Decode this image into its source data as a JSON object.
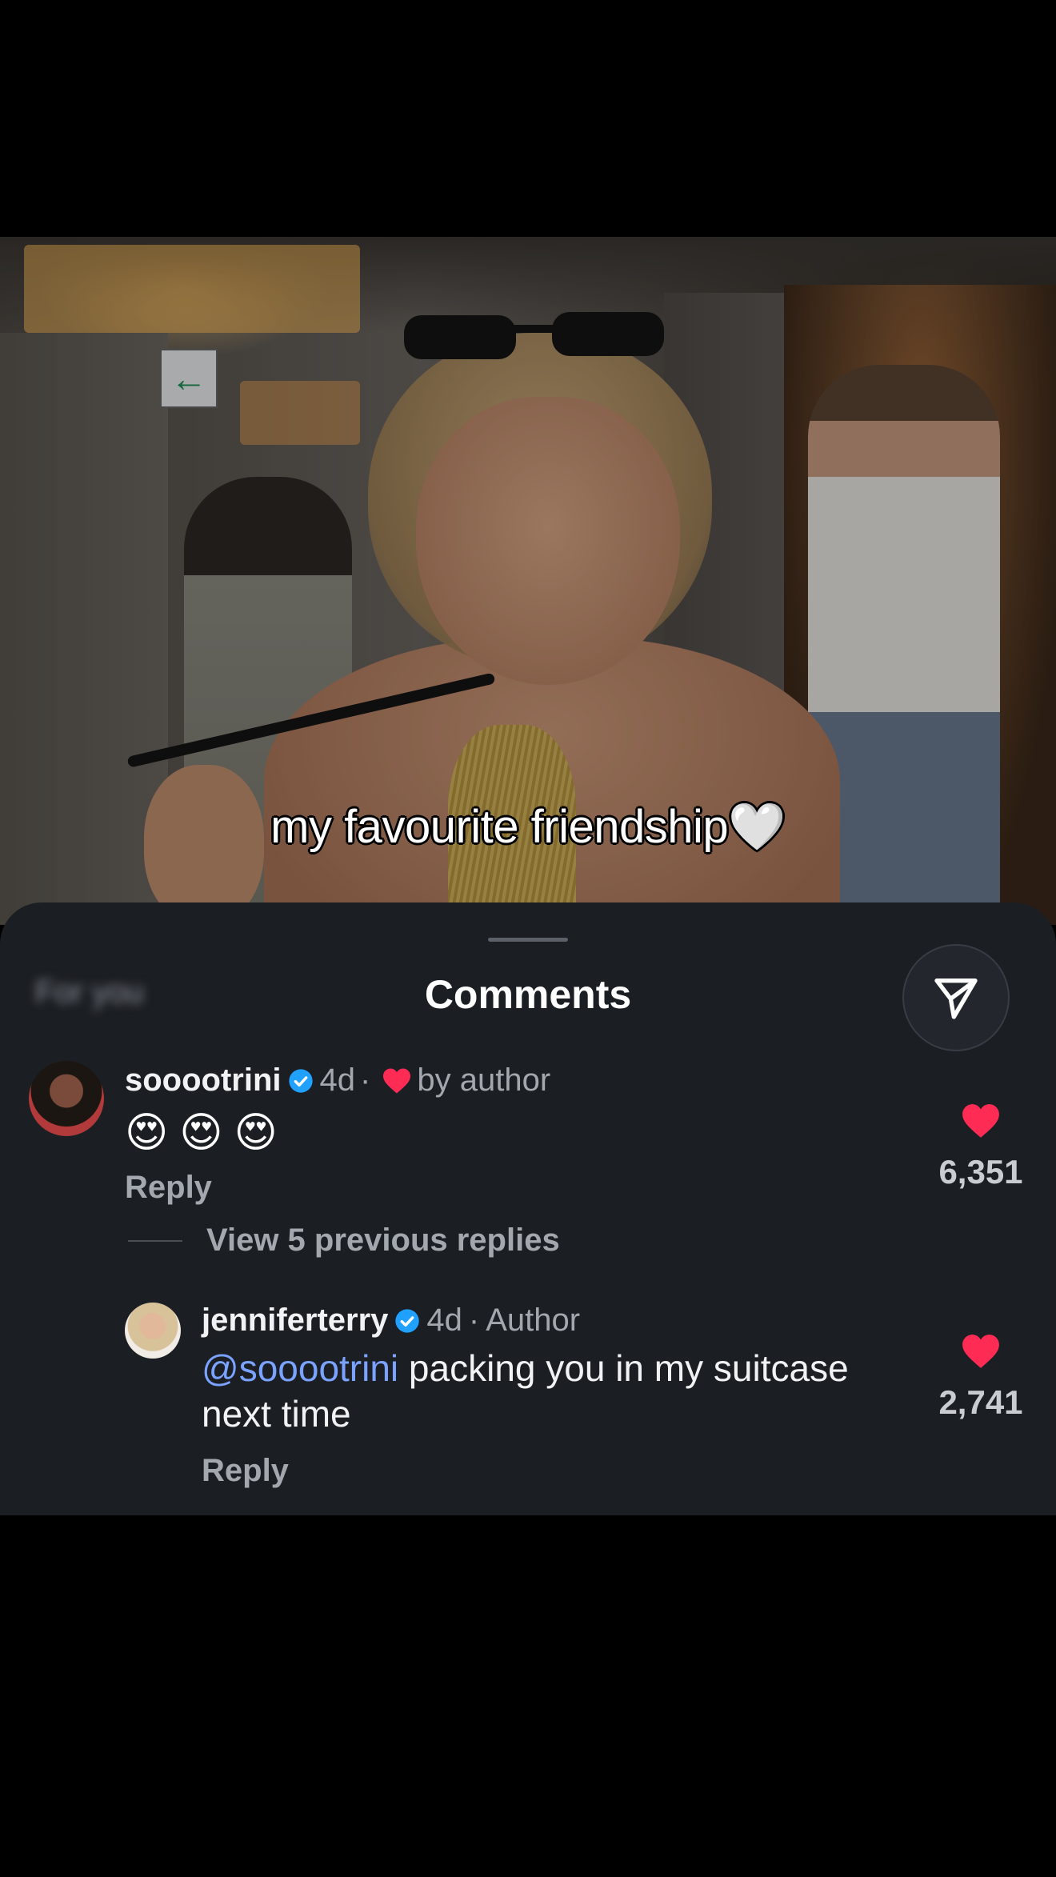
{
  "video": {
    "caption": "my favourite friendship",
    "caption_emoji": "🤍"
  },
  "sheet": {
    "tab_label": "For you",
    "title": "Comments",
    "share_icon": "send-icon"
  },
  "comments": [
    {
      "username": "sooootrini",
      "verified": true,
      "time": "4d",
      "separator": "·",
      "badge": "by author",
      "text": "😍 😍 😍",
      "emojis": [
        "😍",
        "😍",
        "😍"
      ],
      "reply_label": "Reply",
      "likes": "6,351"
    }
  ],
  "view_replies": "View 5 previous replies",
  "replies": [
    {
      "username": "jenniferterry",
      "verified": true,
      "time": "4d",
      "separator": "·",
      "badge": "Author",
      "mention": "@sooootrini",
      "text_line1": " packing you in my suitcase",
      "text_line2": "next time",
      "reply_label": "Reply",
      "likes": "2,741"
    }
  ],
  "colors": {
    "like_red": "#fe2c55",
    "verified_blue": "#20a0ff",
    "mention_blue": "#7aa2ff",
    "sheet_bg": "#1b1e23"
  }
}
